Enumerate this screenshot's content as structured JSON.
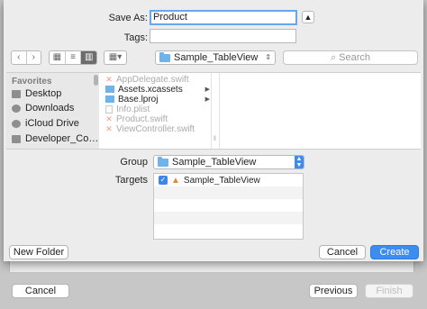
{
  "parent_window": {
    "cancel_label": "Cancel",
    "previous_label": "Previous",
    "finish_label": "Finish"
  },
  "save_as": {
    "label": "Save As:",
    "value": "Product",
    "expand_icon": "chevron-up-icon"
  },
  "tags": {
    "label": "Tags:",
    "value": ""
  },
  "toolbar": {
    "back_icon": "chevron-left-icon",
    "forward_icon": "chevron-right-icon",
    "view_icons": [
      "icon-view-icon",
      "list-view-icon",
      "column-view-icon"
    ],
    "group_icon": "grid-icon",
    "location": "Sample_TableView",
    "search_placeholder": "Search"
  },
  "sidebar": {
    "heading": "Favorites",
    "items": [
      {
        "label": "Desktop",
        "icon": "desktop-icon"
      },
      {
        "label": "Downloads",
        "icon": "downloads-icon"
      },
      {
        "label": "iCloud Drive",
        "icon": "cloud-icon"
      },
      {
        "label": "Developer_Co…",
        "icon": "folder-icon"
      }
    ]
  },
  "files": [
    {
      "name": "AppDelegate.swift",
      "enabled": false,
      "icon": "swift-icon"
    },
    {
      "name": "Assets.xcassets",
      "enabled": true,
      "icon": "folder-icon"
    },
    {
      "name": "Base.lproj",
      "enabled": true,
      "icon": "folder-icon"
    },
    {
      "name": "Info.plist",
      "enabled": false,
      "icon": "plist-icon"
    },
    {
      "name": "Product.swift",
      "enabled": false,
      "icon": "swift-icon"
    },
    {
      "name": "ViewController.swift",
      "enabled": false,
      "icon": "swift-icon"
    }
  ],
  "group": {
    "label": "Group",
    "value": "Sample_TableView"
  },
  "targets": {
    "label": "Targets",
    "items": [
      {
        "name": "Sample_TableView",
        "checked": true
      }
    ]
  },
  "buttons": {
    "new_folder": "New Folder",
    "cancel": "Cancel",
    "create": "Create"
  },
  "colors": {
    "accent": "#3d8cf0",
    "folder": "#6fb3ea"
  }
}
